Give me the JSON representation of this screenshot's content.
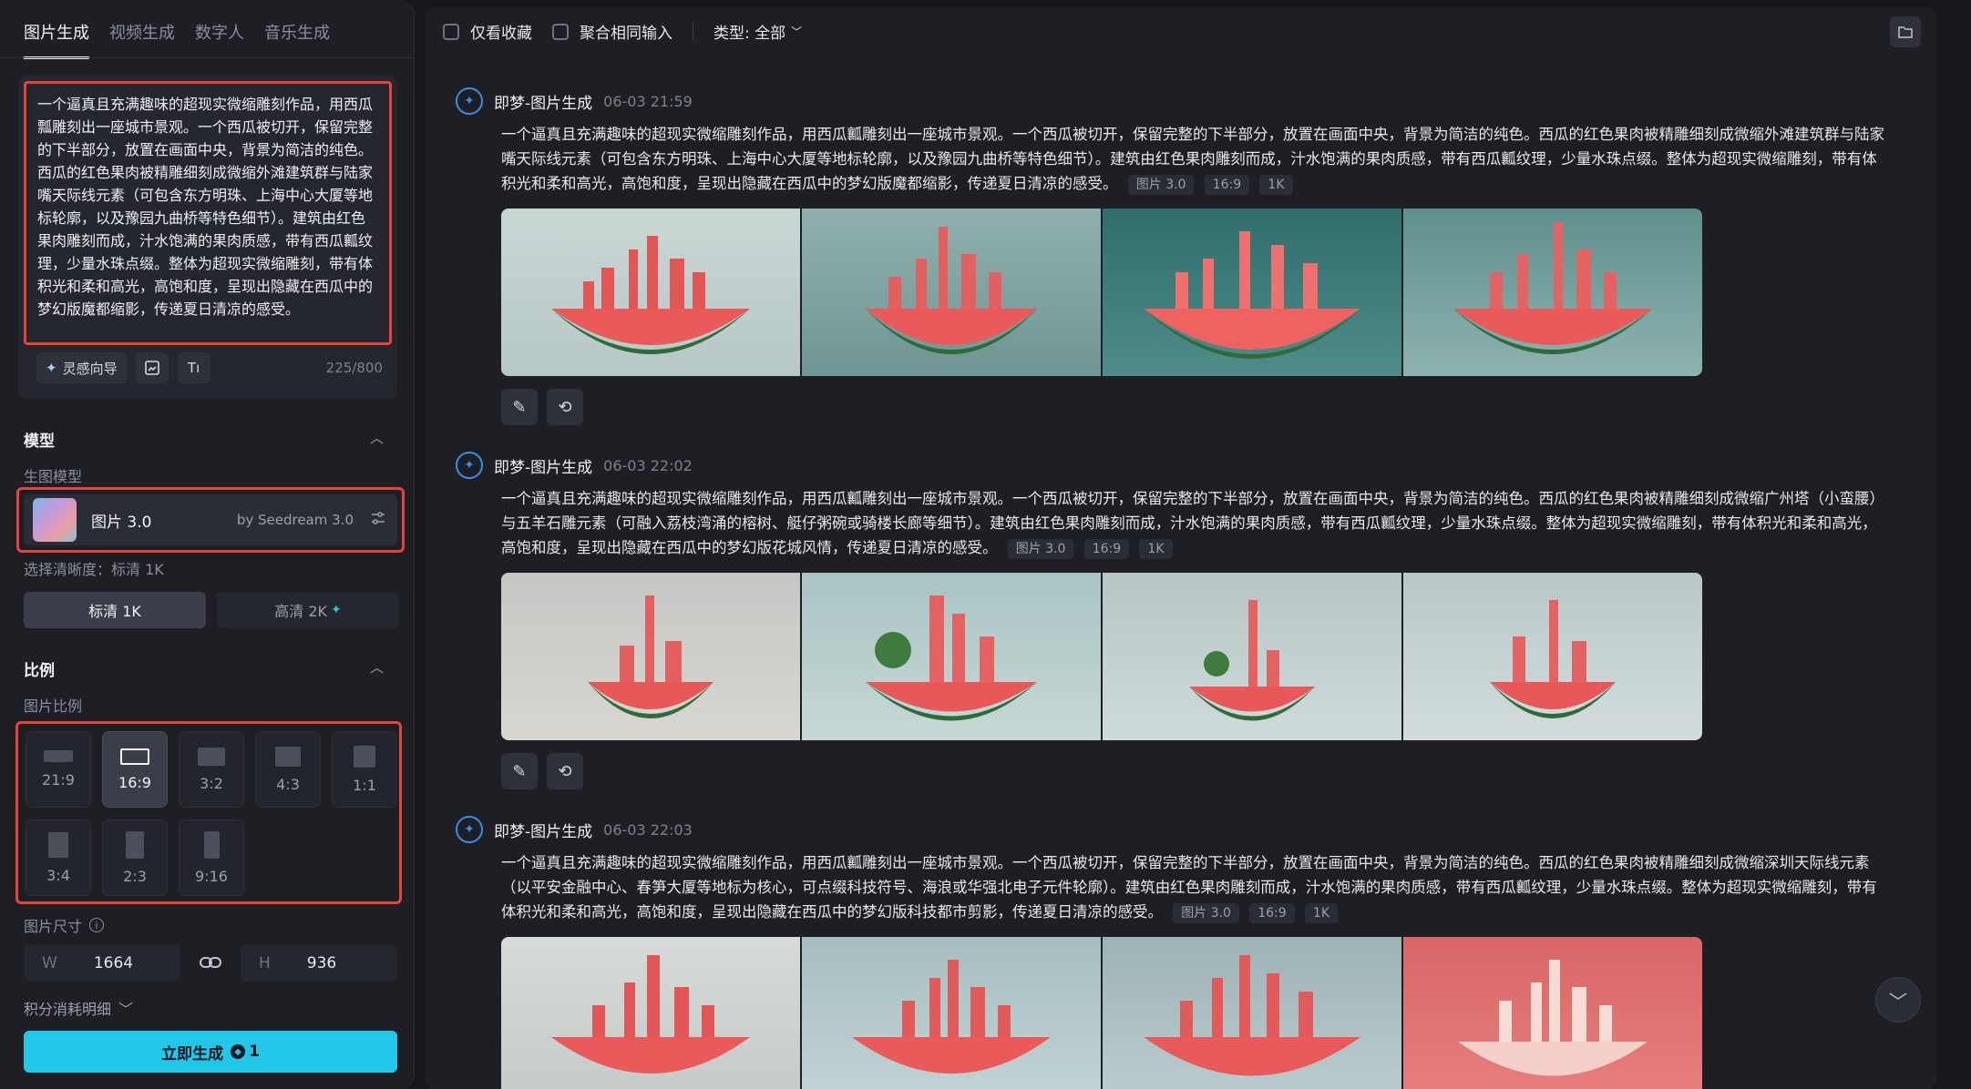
{
  "tabs": [
    "图片生成",
    "视频生成",
    "数字人",
    "音乐生成"
  ],
  "prompt": {
    "text": "一个逼真且充满趣味的超现实微缩雕刻作品，用西瓜瓢雕刻出一座城市景观。一个西瓜被切开，保留完整的下半部分，放置在画面中央，背景为简洁的纯色。西瓜的红色果肉被精雕细刻成微缩外滩建筑群与陆家嘴天际线元素（可包含东方明珠、上海中心大厦等地标轮廓，以及豫园九曲桥等特色细节）。建筑由红色果肉雕刻而成，汁水饱满的果肉质感，带有西瓜瓤纹理，少量水珠点缀。整体为超现实微缩雕刻，带有体积光和柔和高光，高饱和度，呈现出隐藏在西瓜中的梦幻版魔都缩影，传递夏日清凉的感受。",
    "inspiration_label": "灵感向导",
    "counter": "225/800"
  },
  "model_section": {
    "title": "模型",
    "sub_label": "生图模型",
    "model_name": "图片 3.0",
    "model_by": "by Seedream 3.0",
    "res_label": "选择清晰度：标清 1K",
    "res_options": [
      "标清 1K",
      "高清 2K"
    ]
  },
  "ratio_section": {
    "title": "比例",
    "sub_label": "图片比例",
    "ratios": [
      "21:9",
      "16:9",
      "3:2",
      "4:3",
      "1:1",
      "3:4",
      "2:3",
      "9:16"
    ],
    "selected": "16:9"
  },
  "size": {
    "label": "图片尺寸",
    "w_key": "W",
    "w_value": "1664",
    "h_key": "H",
    "h_value": "936"
  },
  "credits": {
    "label": "积分消耗明细",
    "generate_label": "立即生成",
    "cost": "1"
  },
  "topbar": {
    "favorites_label": "仅看收藏",
    "aggregate_label": "聚合相同输入",
    "type_filter": "类型: 全部"
  },
  "entries": [
    {
      "name": "即梦-图片生成",
      "time": "06-03  21:59",
      "text": "一个逼真且充满趣味的超现实微缩雕刻作品，用西瓜瓤雕刻出一座城市景观。一个西瓜被切开，保留完整的下半部分，放置在画面中央，背景为简洁的纯色。西瓜的红色果肉被精雕细刻成微缩外滩建筑群与陆家嘴天际线元素（可包含东方明珠、上海中心大厦等地标轮廓，以及豫园九曲桥等特色细节）。建筑由红色果肉雕刻而成，汁水饱满的果肉质感，带有西瓜瓤纹理，少量水珠点缀。整体为超现实微缩雕刻，带有体积光和柔和高光，高饱和度，呈现出隐藏在西瓜中的梦幻版魔都缩影，传递夏日清凉的感受。",
      "tags": [
        "图片 3.0",
        "16:9",
        "1K"
      ]
    },
    {
      "name": "即梦-图片生成",
      "time": "06-03  22:02",
      "text": "一个逼真且充满趣味的超现实微缩雕刻作品，用西瓜瓤雕刻出一座城市景观。一个西瓜被切开，保留完整的下半部分，放置在画面中央，背景为简洁的纯色。西瓜的红色果肉被精雕细刻成微缩广州塔（小蛮腰）与五羊石雕元素（可融入荔枝湾涌的榕树、艇仔粥碗或骑楼长廊等细节）。建筑由红色果肉雕刻而成，汁水饱满的果肉质感，带有西瓜瓤纹理，少量水珠点缀。整体为超现实微缩雕刻，带有体积光和柔和高光，高饱和度，呈现出隐藏在西瓜中的梦幻版花城风情，传递夏日清凉的感受。",
      "tags": [
        "图片 3.0",
        "16:9",
        "1K"
      ]
    },
    {
      "name": "即梦-图片生成",
      "time": "06-03  22:03",
      "text": "一个逼真且充满趣味的超现实微缩雕刻作品，用西瓜瓤雕刻出一座城市景观。一个西瓜被切开，保留完整的下半部分，放置在画面中央，背景为简洁的纯色。西瓜的红色果肉被精雕细刻成微缩深圳天际线元素（以平安金融中心、春笋大厦等地标为核心，可点缀科技符号、海浪或华强北电子元件轮廓）。建筑由红色果肉雕刻而成，汁水饱满的果肉质感，带有西瓜瓤纹理，少量水珠点缀。整体为超现实微缩雕刻，带有体积光和柔和高光，高饱和度，呈现出隐藏在西瓜中的梦幻版科技都市剪影，传递夏日清凉的感受。",
      "tags": [
        "图片 3.0",
        "16:9",
        "1K"
      ]
    }
  ],
  "colors": {
    "accent": "#22c6e6",
    "highlight_border": "#e8433a",
    "logo_blue": "#3b8de6"
  }
}
